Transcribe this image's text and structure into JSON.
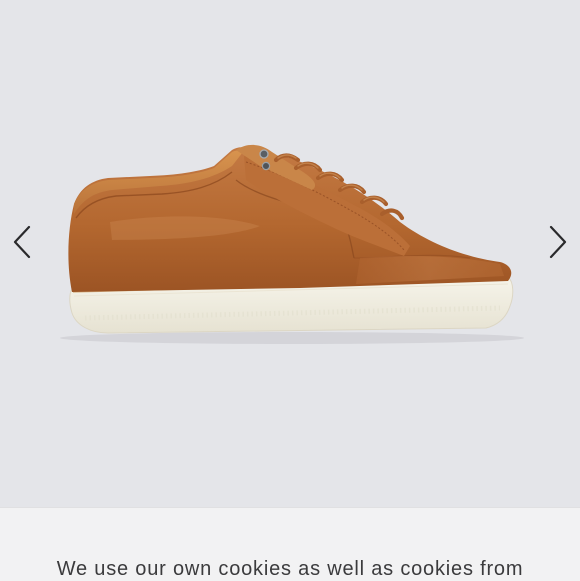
{
  "gallery": {
    "image_alt": "Brown leather low-top sneaker with white sole",
    "prev_icon": "chevron-left-icon",
    "next_icon": "chevron-right-icon"
  },
  "cookie_banner": {
    "text": "We use our own cookies as well as cookies from"
  },
  "colors": {
    "background": "#e4e5e9",
    "leather": "#b66a37",
    "sole": "#f1efe3",
    "banner_bg": "#f2f2f3",
    "banner_text": "#3b3b3d"
  }
}
